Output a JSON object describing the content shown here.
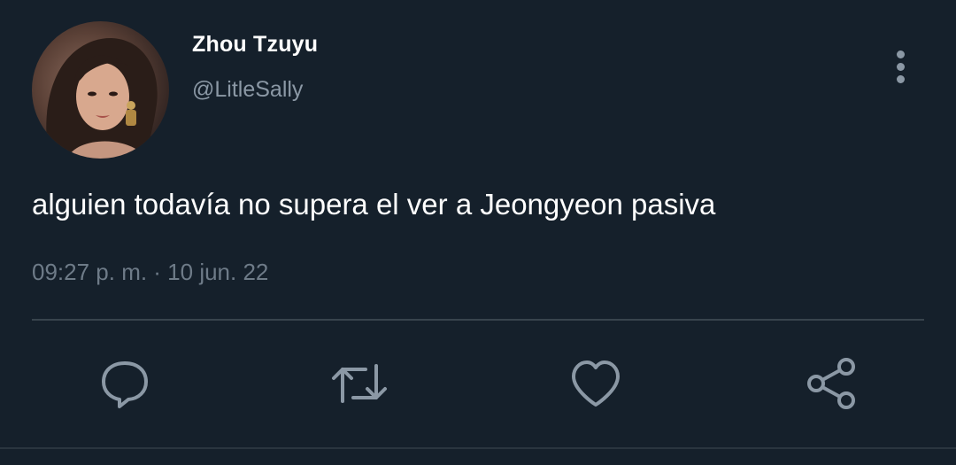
{
  "tweet": {
    "author": {
      "display_name": "Zhou Tzuyu",
      "handle": "@LitleSally",
      "avatar": "profile-photo"
    },
    "text": "alguien todavía no supera el ver a Jeongyeon pasiva",
    "time": "09:27 p. m.",
    "separator": "·",
    "date": "10 jun. 22",
    "meta": "09:27 p. m. · 10 jun. 22"
  },
  "actions": [
    {
      "icon": "reply-icon"
    },
    {
      "icon": "retweet-icon"
    },
    {
      "icon": "like-icon"
    },
    {
      "icon": "share-icon"
    }
  ],
  "menu": {
    "icon": "more-options-icon"
  },
  "colors": {
    "background": "#15202b",
    "primary_text": "#ffffff",
    "secondary_text": "#8b98a5",
    "divider": "#38444d"
  }
}
